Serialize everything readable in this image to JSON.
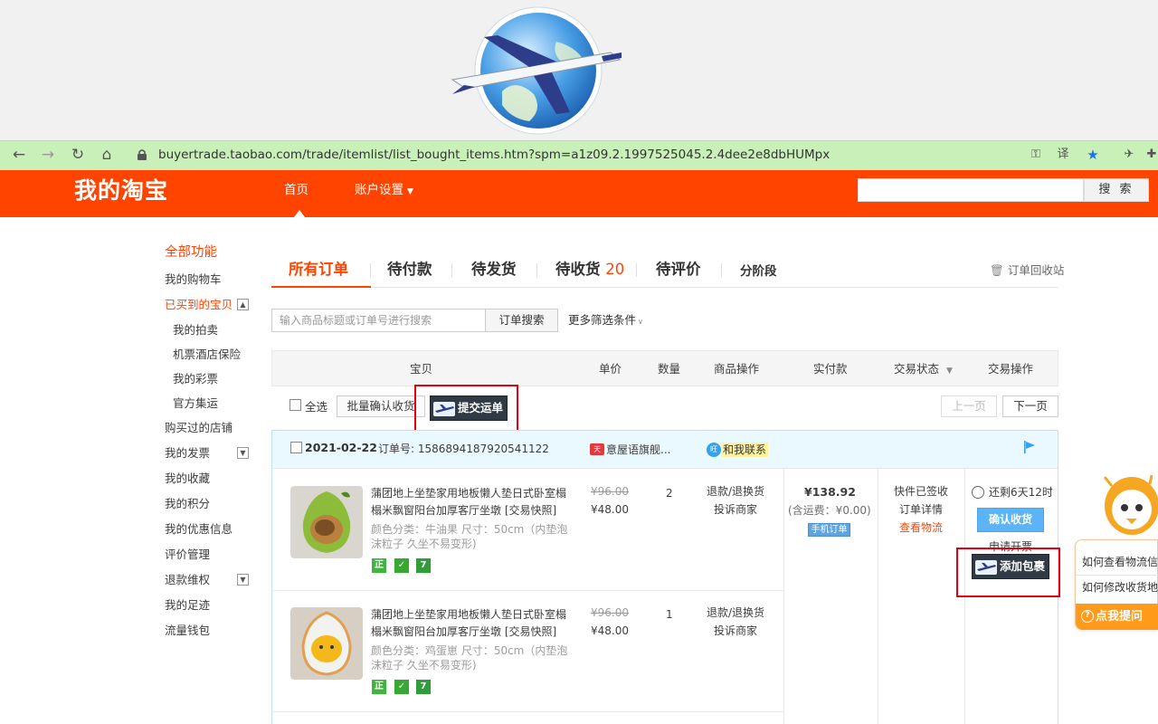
{
  "browser": {
    "url": "buyertrade.taobao.com/trade/itemlist/list_bought_items.htm?spm=a1z09.2.1997525045.2.4dee2e8dbHUMpx"
  },
  "header": {
    "brand": "我的淘宝",
    "nav_home": "首页",
    "nav_account": "账户设置",
    "search_button": "搜 索"
  },
  "sidebar": {
    "all": "全部功能",
    "cart": "我的购物车",
    "bought": "已买到的宝贝",
    "auction": "我的拍卖",
    "travel": "机票酒店保险",
    "lottery": "我的彩票",
    "official": "官方集运",
    "shops": "购买过的店铺",
    "invoice": "我的发票",
    "favorites": "我的收藏",
    "points": "我的积分",
    "coupons": "我的优惠信息",
    "reviews": "评价管理",
    "refund": "退款维权",
    "footprints": "我的足迹",
    "dataflow": "流量钱包"
  },
  "tabs": {
    "all": "所有订单",
    "unpaid": "待付款",
    "unshipped": "待发货",
    "unreceived": "待收货",
    "unreceived_count": "20",
    "unreviewed": "待评价",
    "phased": "分阶段",
    "recycle": "订单回收站"
  },
  "filter": {
    "search_placeholder": "输入商品标题或订单号进行搜索",
    "search_button": "订单搜索",
    "more": "更多筛选条件"
  },
  "columns": {
    "item": "宝贝",
    "unit_price": "单价",
    "quantity": "数量",
    "item_ops": "商品操作",
    "paid": "实付款",
    "status": "交易状态",
    "trade_ops": "交易操作"
  },
  "actions": {
    "select_all": "全选",
    "batch_confirm": "批量确认收货",
    "submit_waybill": "提交运单",
    "prev": "上一页",
    "next": "下一页"
  },
  "order": {
    "date": "2021-02-22",
    "order_no": "订单号: 1586894187920541122",
    "shop": "意屋语旗舰...",
    "contact": "和我联系",
    "total": "¥138.92",
    "freight": "(含运费：¥0.00)",
    "mobile_tag": "手机订单",
    "status_lines": [
      "快件已签收",
      "订单详情",
      "查看物流"
    ],
    "countdown": "还剩6天12时",
    "confirm_button": "确认收货",
    "invoice": "申请开票",
    "add_package": "添加包裹",
    "items": [
      {
        "title": "蒲团地上坐垫家用地板懒人垫日式卧室榻榻米飘窗阳台加厚客厅坐墩 [交易快照]",
        "attrs": "颜色分类：牛油果  尺寸：50cm（内垫泡沫粒子 久坐不易变形)",
        "old_price": "¥96.00",
        "price": "¥48.00",
        "qty": "2",
        "op1": "退款/退换货",
        "op2": "投诉商家"
      },
      {
        "title": "蒲团地上坐垫家用地板懒人垫日式卧室榻榻米飘窗阳台加厚客厅坐墩 [交易快照]",
        "attrs": "颜色分类：鸡蛋崽  尺寸：50cm（内垫泡沫粒子 久坐不易变形)",
        "old_price": "¥96.00",
        "price": "¥48.00",
        "qty": "1",
        "op1": "退款/退换货",
        "op2": "投诉商家"
      }
    ]
  },
  "helper": {
    "q1": "如何查看物流信息",
    "q2": "如何修改收货地址",
    "button": "点我提问"
  },
  "colors": {
    "brand_orange": "#ff4400",
    "address_bar": "#c9f0b8",
    "waybill_button": "#2f3a45",
    "highlight_box": "#e60012"
  }
}
